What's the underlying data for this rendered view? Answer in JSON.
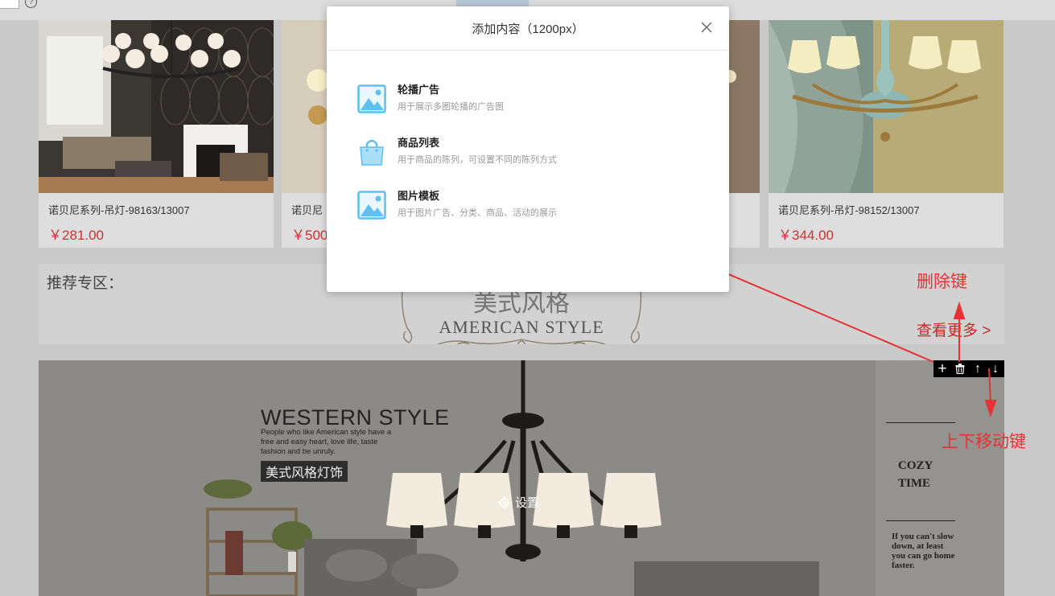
{
  "topbar": {
    "help_glyph": "?"
  },
  "products": [
    {
      "name": "诺贝尼系列-吊灯-98163/13007",
      "price": "￥281.00"
    },
    {
      "name": "诺贝尼",
      "price": "￥500"
    },
    {
      "name": "",
      "price": ""
    },
    {
      "name": "诺贝尼系列-吊灯-98152/13007",
      "price": "￥344.00"
    }
  ],
  "recommend": {
    "title": "推荐专区：",
    "style_cn": "美式风格",
    "style_en": "AMERICAN STYLE",
    "more_link": "查看更多 >"
  },
  "banner": {
    "western_title": "WESTERN STYLE",
    "western_desc": "People who like American style have a free and easy heart, love life, taste fashion and be unruly.",
    "tag": "美式风格灯饰",
    "cozy": "COZY TIME",
    "slow_text": "If you can't slow down, at least you can go home faster.",
    "settings_label": "设置",
    "toolbar": {
      "add": "+",
      "up": "↑",
      "down": "↓"
    }
  },
  "annotations": {
    "delete_key": "删除键",
    "move_keys": "上下移动键"
  },
  "modal": {
    "title": "添加内容（1200px）",
    "items": [
      {
        "name": "轮播广告",
        "desc": "用于展示多图轮播的广告图",
        "icon": "image-icon"
      },
      {
        "name": "商品列表",
        "desc": "用于商品的陈列，可设置不同的陈列方式",
        "icon": "shopping-bag-icon"
      },
      {
        "name": "图片模板",
        "desc": "用于图片广告、分类、商品、活动的展示",
        "icon": "image-icon"
      }
    ]
  },
  "colors": {
    "price_red": "#c33333",
    "annotation_red": "#e53434",
    "icon_blue": "#5cc1f0",
    "toolbar_bg": "#000000"
  }
}
